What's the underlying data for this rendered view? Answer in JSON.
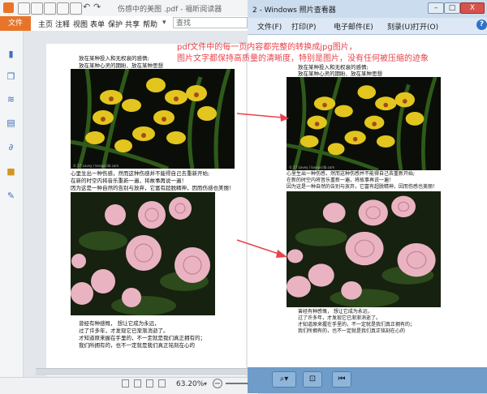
{
  "foxit": {
    "title": "伤感中的美图 .pdf - 福昕阅读器",
    "menu": {
      "file": "文件",
      "items": [
        "主页",
        "注释",
        "视图",
        "表单",
        "保护",
        "共享",
        "帮助"
      ]
    },
    "search_placeholder": "查找",
    "zoom": "63.20%"
  },
  "photo_viewer": {
    "title": "2 - Windows 照片查看器",
    "toolbar": [
      "文件(F)",
      "打印(P)",
      "电子邮件(E)",
      "刻录(U)",
      "打开(O)"
    ],
    "help": "?",
    "window_buttons": {
      "minimize": "–",
      "maximize": "□",
      "close": "X"
    }
  },
  "document": {
    "intro": [
      "放在某种投入和无权衰的感情;",
      "放在某种心灵的期盼、放在某种思想"
    ],
    "middle": [
      "心里生出一种伤感，然而这种伤感并不能得自己去重新开始;",
      "在新的时空内将音乐重新一遍，将故事再说一遍！",
      "因为这是一种自然的告别与放弃，它富有超脱精神，因而伤感也美丽！"
    ],
    "end": [
      "曾经有种感慨，  想让它成为永远，",
      "过了许多年，才发现它已渐渐消逝了。",
      "才知道原来握在手里的，不一定就是我们真正拥有的；",
      "我们所拥有的，也不一定就是我们真正铭刻在心的"
    ],
    "image_caption": "© 57 Lovey / lovepiclib.com"
  },
  "annotation": {
    "lines": [
      "pdf文件中的每一页内容都完整的转换成jpg图片，",
      "图片文字都保持高质量的清晰度，特别是图片，没有任何被压缩的迹象"
    ]
  },
  "colors": {
    "accent": "#e8742a",
    "annotation": "#e8424a"
  }
}
